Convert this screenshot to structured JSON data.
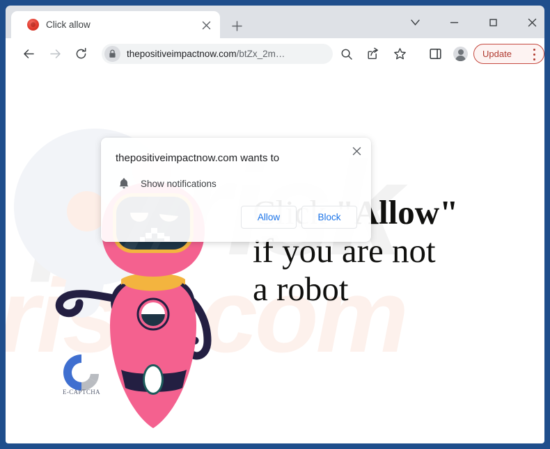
{
  "browser": {
    "tab": {
      "title": "Click allow",
      "favicon": "red-dot-favicon",
      "close_icon": "close-icon"
    },
    "new_tab_icon": "plus-icon",
    "window_controls": [
      {
        "name": "chevron-down-icon",
        "glyph": "⌄"
      },
      {
        "name": "minimize-icon",
        "glyph": "–"
      },
      {
        "name": "maximize-icon",
        "glyph": "□"
      },
      {
        "name": "close-icon",
        "glyph": "✕"
      }
    ],
    "toolbar": {
      "back_icon": "back-arrow-icon",
      "forward_icon": "forward-arrow-icon",
      "reload_icon": "reload-icon",
      "lock_icon": "lock-icon",
      "url_domain": "thepositiveimpactnow.com",
      "url_path": "/btZx_2m…",
      "search_icon": "search-icon",
      "share_icon": "share-icon",
      "bookmark_icon": "star-icon",
      "side_panel_icon": "side-panel-icon",
      "profile_icon": "profile-avatar-icon",
      "update_label": "Update",
      "update_menu_icon": "three-dot-menu-icon",
      "update_accent_color": "#b03a30"
    }
  },
  "permission_dialog": {
    "title": "thepositiveimpactnow.com wants to",
    "permission_icon": "bell-icon",
    "permission_label": "Show notifications",
    "allow_label": "Allow",
    "block_label": "Block",
    "close_icon": "close-icon",
    "link_color": "#1a73e8"
  },
  "page": {
    "headline": {
      "line1_prefix": "Click ",
      "line1_bold": "\"Allow\"",
      "line2": "if you are not",
      "line3": "a robot"
    },
    "captcha": {
      "logo_icon": "c-captcha-logo-icon",
      "label": "E-CAPTCHA",
      "logo_blue": "#3f6fd0",
      "logo_gray": "#b9bcc1"
    },
    "robot": {
      "name": "captcha-robot-illustration",
      "body_color": "#f4618f",
      "visor_color": "#1d3445",
      "visor_rim_color": "#f3b43f",
      "limb_color": "#231f42",
      "collar_color": "#f3b43f"
    },
    "watermark_gray": "pcrisk",
    "watermark_pink": "risk.com",
    "frame_color": "#1f4e8c"
  }
}
